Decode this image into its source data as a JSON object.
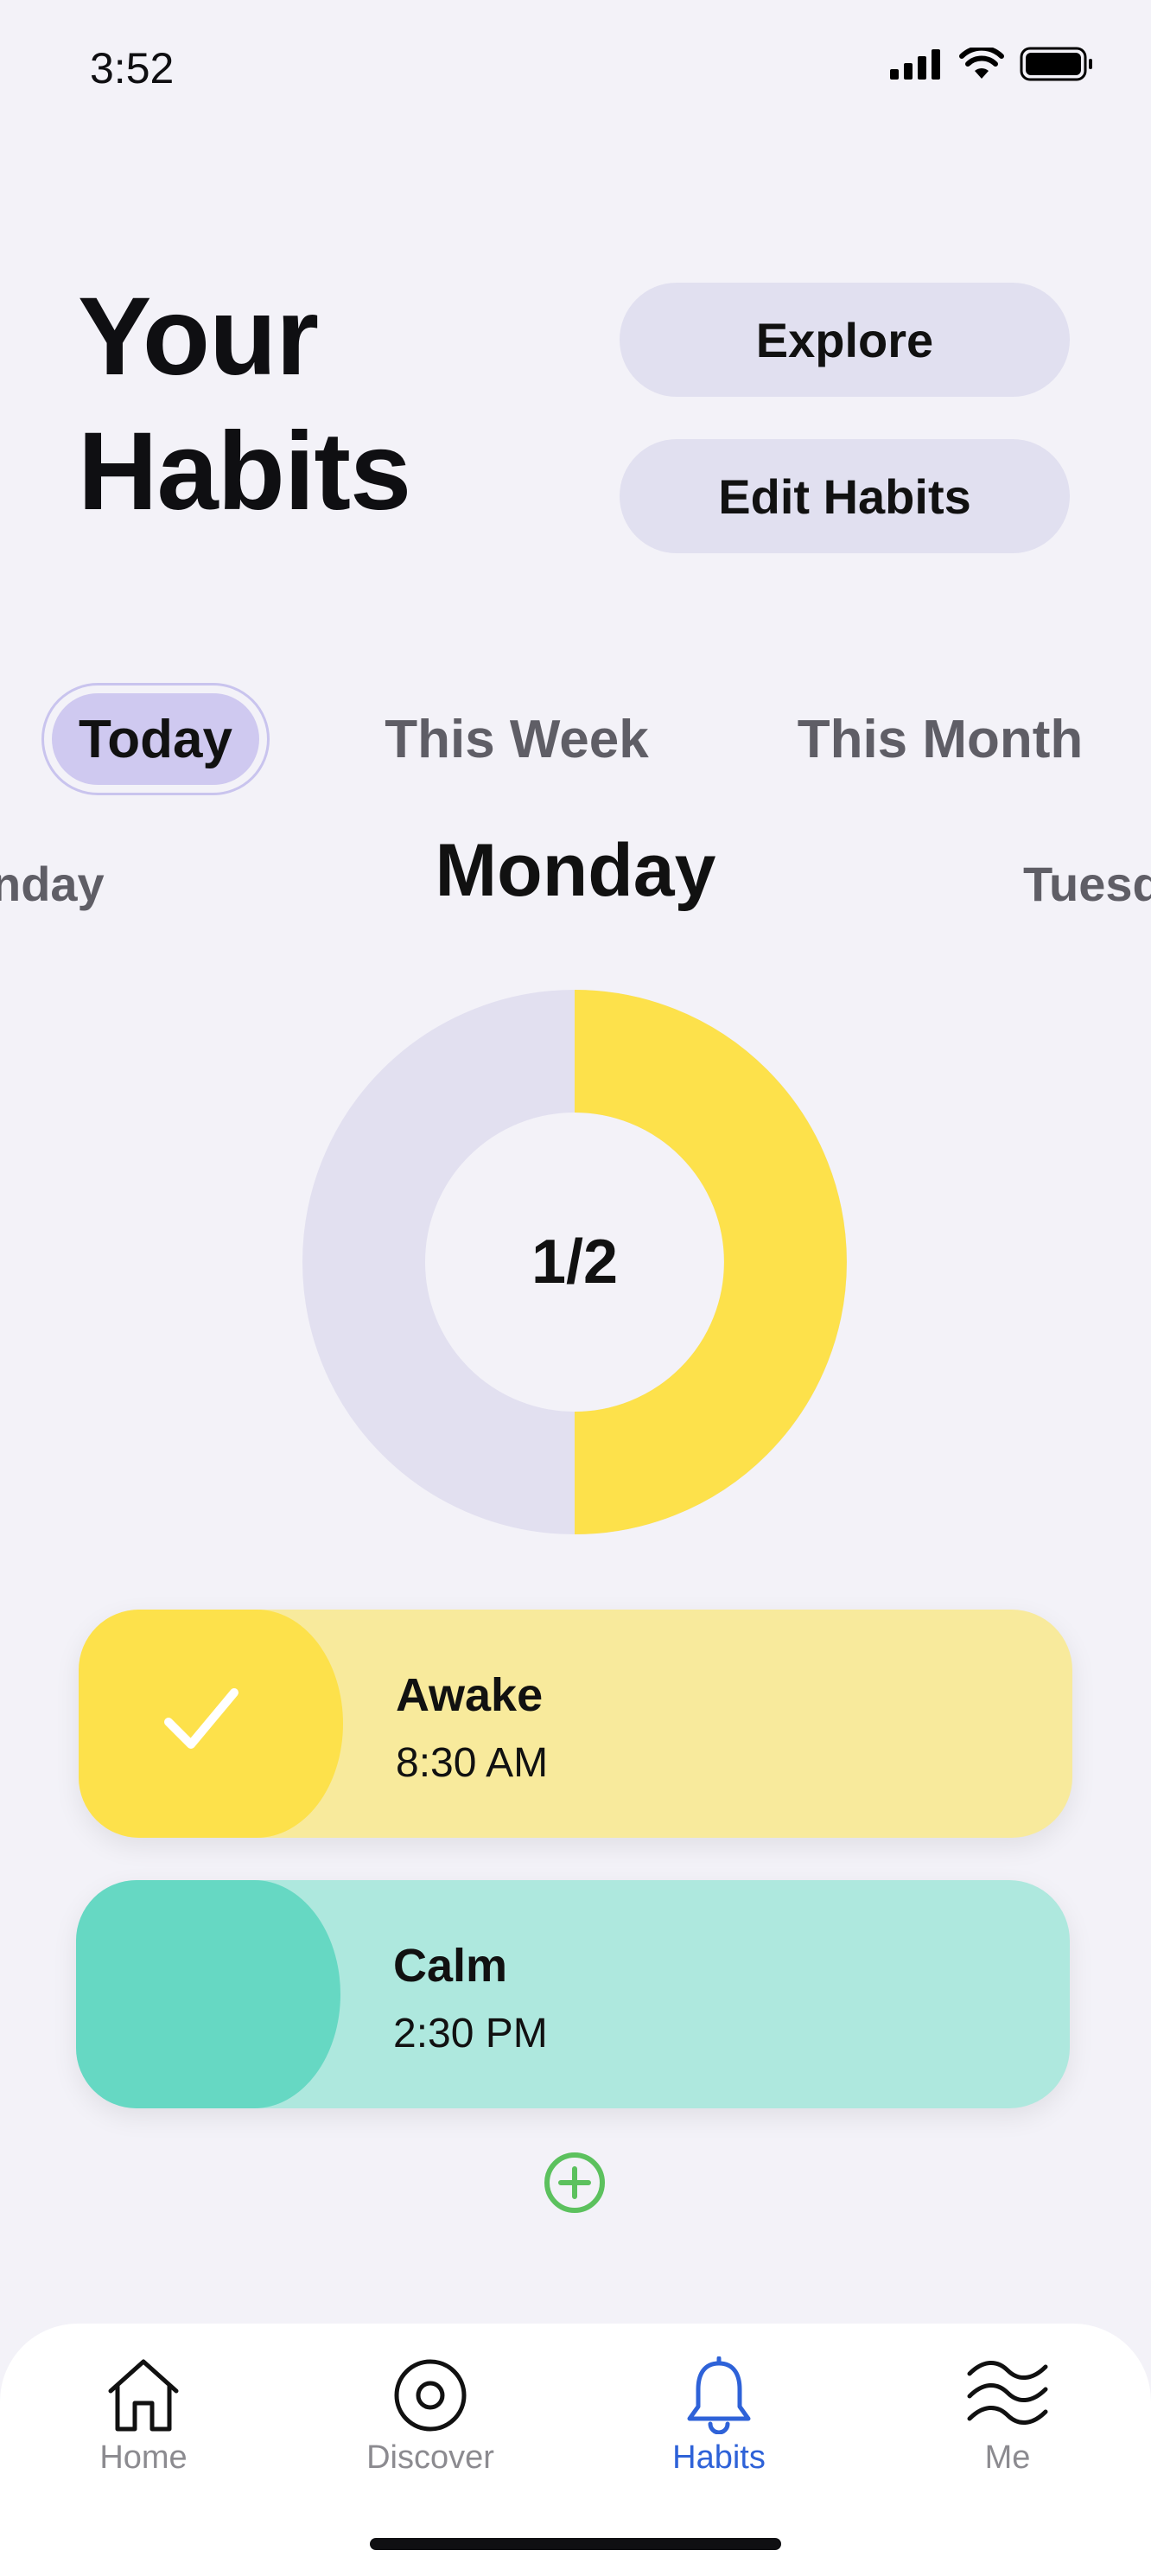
{
  "status_bar": {
    "time": "3:52"
  },
  "header": {
    "title_line1": "Your",
    "title_line2": "Habits",
    "explore_label": "Explore",
    "edit_label": "Edit Habits"
  },
  "tabs": [
    {
      "label": "Today",
      "selected": true
    },
    {
      "label": "This Week",
      "selected": false
    },
    {
      "label": "This Month",
      "selected": false
    }
  ],
  "days": {
    "previous": "nday",
    "current": "Monday",
    "next": "Tuesd"
  },
  "progress": {
    "label": "1/2",
    "completed": 1,
    "total": 2,
    "fill_color": "#fde14b",
    "track_color": "#e2e0f0"
  },
  "habits": [
    {
      "name": "Awake",
      "time": "8:30 AM",
      "done": true,
      "lead_color": "#fde14b",
      "card_color": "#f8ea9c",
      "icon": "checkmark-icon"
    },
    {
      "name": "Calm",
      "time": "2:30 PM",
      "done": false,
      "lead_color": "#66d8c3",
      "card_color": "#aee8de"
    }
  ],
  "add_icon": "plus-circle-icon",
  "nav": [
    {
      "label": "Home",
      "icon": "home-icon",
      "active": false
    },
    {
      "label": "Discover",
      "icon": "target-icon",
      "active": false
    },
    {
      "label": "Habits",
      "icon": "bell-icon",
      "active": true
    },
    {
      "label": "Me",
      "icon": "waves-icon",
      "active": false
    }
  ],
  "colors": {
    "accent": "#2e62d8",
    "add": "#5cc15e",
    "background": "#f3f2f8"
  }
}
